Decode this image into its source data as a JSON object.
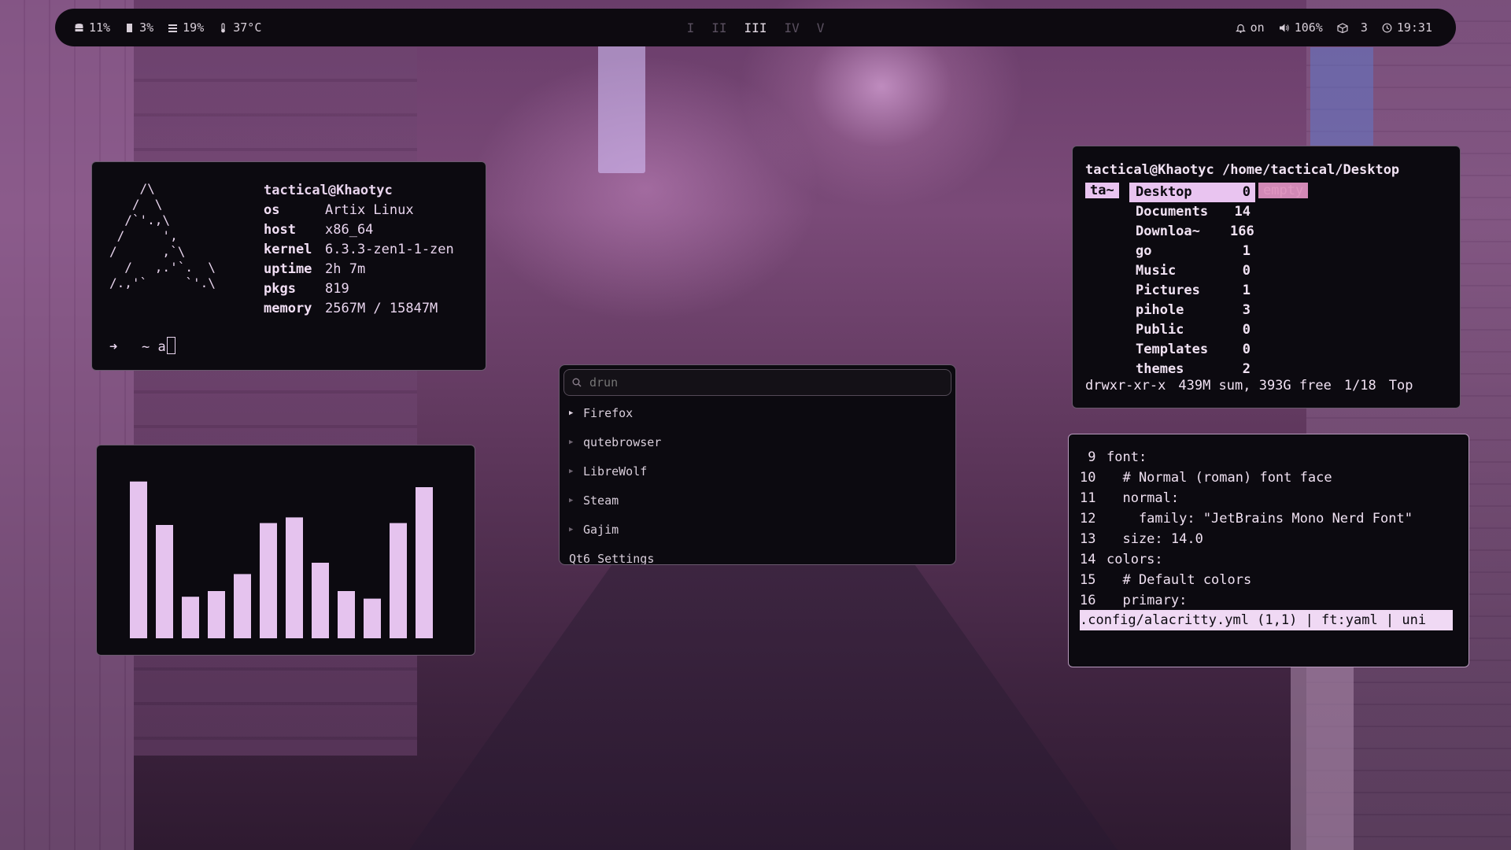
{
  "bar": {
    "stats": [
      {
        "icon": "disk-icon",
        "value": "11%"
      },
      {
        "icon": "cpu-icon",
        "value": "3%"
      },
      {
        "icon": "memory-icon",
        "value": "19%"
      },
      {
        "icon": "thermometer-icon",
        "value": "37°C"
      }
    ],
    "workspaces": [
      "I",
      "II",
      "III",
      "IV",
      "V"
    ],
    "active_workspace": "III",
    "notifications": "on",
    "volume": "106%",
    "updates": "3",
    "clock": "19:31"
  },
  "fetch": {
    "ascii": "    /\\\n   /  \\\n  /`'.,\\\n /     ',\n/      ,`\\\n  /   ,.'`.  \\\n/.,'`     `'.\\",
    "user": "tactical@Khaotyc",
    "rows": [
      {
        "key": "os",
        "value": "Artix Linux"
      },
      {
        "key": "host",
        "value": "x86_64"
      },
      {
        "key": "kernel",
        "value": "6.3.3-zen1-1-zen"
      },
      {
        "key": "uptime",
        "value": "2h 7m"
      },
      {
        "key": "pkgs",
        "value": "819"
      },
      {
        "key": "memory",
        "value": "2567M / 15847M"
      }
    ],
    "prompt_symbol": "➜",
    "prompt_dir": "~",
    "prompt_input": "a"
  },
  "visualizer": {
    "levels": [
      0.83,
      0.6,
      0.22,
      0.25,
      0.34,
      0.61,
      0.64,
      0.4,
      0.25,
      0.21,
      0.61,
      0.8
    ],
    "color": "#e5c3ee"
  },
  "launcher": {
    "placeholder": "drun",
    "apps": [
      "Firefox",
      "qutebrowser",
      "LibreWolf",
      "Steam",
      "Gajim",
      "Qt6 Settings"
    ]
  },
  "filemanager": {
    "path": "tactical@Khaotyc /home/tactical/Desktop",
    "parent": "ta~",
    "entries": [
      {
        "name": "Desktop",
        "count": "0",
        "selected": true
      },
      {
        "name": "Documents",
        "count": "14"
      },
      {
        "name": "Downloa~",
        "count": "166"
      },
      {
        "name": "go",
        "count": "1"
      },
      {
        "name": "Music",
        "count": "0"
      },
      {
        "name": "Pictures",
        "count": "1"
      },
      {
        "name": "pihole",
        "count": "3"
      },
      {
        "name": "Public",
        "count": "0"
      },
      {
        "name": "Templates",
        "count": "0"
      },
      {
        "name": "themes",
        "count": "2"
      }
    ],
    "preview": "empty",
    "status": {
      "perms": "drwxr-xr-x",
      "summary": "439M sum, 393G free",
      "position": "1/18",
      "scroll": "Top"
    }
  },
  "editor": {
    "lines": [
      {
        "n": " 9",
        "text": "font:"
      },
      {
        "n": "10",
        "text": "  # Normal (roman) font face"
      },
      {
        "n": "11",
        "text": "  normal:"
      },
      {
        "n": "12",
        "text": "    family: \"JetBrains Mono Nerd Font\""
      },
      {
        "n": "13",
        "text": "  size: 14.0"
      },
      {
        "n": "14",
        "text": "colors:"
      },
      {
        "n": "15",
        "text": "  # Default colors"
      },
      {
        "n": "16",
        "text": "  primary:"
      }
    ],
    "statusline": ".config/alacritty.yml (1,1) | ft:yaml | uni"
  }
}
